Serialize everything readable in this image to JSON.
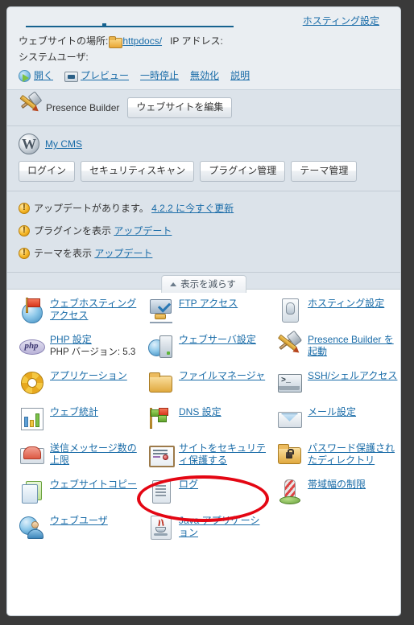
{
  "summary": {
    "hosting_setting_link": "ホスティング設定",
    "website_location_label": "ウェブサイトの場所:",
    "httpdocs_link": "httpdocs/",
    "ip_address_label": "IP アドレス:",
    "system_user_label": "システムユーザ:",
    "actions": [
      {
        "label": "開く",
        "icon": "open-globe-icon"
      },
      {
        "label": "プレビュー",
        "icon": "preview-icon"
      },
      {
        "label": "一時停止",
        "icon": ""
      },
      {
        "label": "無効化",
        "icon": ""
      },
      {
        "label": "説明",
        "icon": ""
      }
    ]
  },
  "presence_builder": {
    "title": "Presence Builder",
    "edit_button": "ウェブサイトを編集",
    "icon": "pencil-hammer-icon"
  },
  "wordpress": {
    "site_link": "My CMS",
    "icon": "wordpress-icon",
    "buttons": [
      "ログイン",
      "セキュリティスキャン",
      "プラグイン管理",
      "テーマ管理"
    ]
  },
  "notifications": [
    {
      "icon": "warning-icon",
      "text": "アップデートがあります。",
      "link": "4.2.2 に今すぐ更新"
    },
    {
      "icon": "warning-icon",
      "text": "プラグインを表示",
      "link": "アップデート"
    },
    {
      "icon": "warning-icon",
      "text": "テーマを表示",
      "link": "アップデート"
    }
  ],
  "collapse_tab": {
    "label": "表示を減らす",
    "icon": "chevron-up-icon"
  },
  "grid": [
    [
      {
        "icon": "web-hosting-access-icon",
        "label": "ウェブホスティングアクセス",
        "sub": ""
      },
      {
        "icon": "ftp-access-icon",
        "label": "FTP アクセス",
        "sub": ""
      },
      {
        "icon": "hosting-settings-icon",
        "label": "ホスティング設定",
        "sub": ""
      }
    ],
    [
      {
        "icon": "php-settings-icon",
        "label": "PHP 設定",
        "sub": "PHP バージョン: 5.3"
      },
      {
        "icon": "web-server-settings-icon",
        "label": "ウェブサーバ設定",
        "sub": ""
      },
      {
        "icon": "presence-builder-icon",
        "label": "Presence Builder を起動",
        "sub": ""
      }
    ],
    [
      {
        "icon": "applications-icon",
        "label": "アプリケーション",
        "sub": ""
      },
      {
        "icon": "file-manager-icon",
        "label": "ファイルマネージャ",
        "sub": ""
      },
      {
        "icon": "ssh-shell-access-icon",
        "label": "SSH/シェルアクセス",
        "sub": ""
      }
    ],
    [
      {
        "icon": "web-statistics-icon",
        "label": "ウェブ統計",
        "sub": ""
      },
      {
        "icon": "dns-settings-icon",
        "label": "DNS 設定",
        "sub": ""
      },
      {
        "icon": "mail-settings-icon",
        "label": "メール設定",
        "sub": ""
      }
    ],
    [
      {
        "icon": "outgoing-mail-limit-icon",
        "label": "送信メッセージ数の上限",
        "sub": ""
      },
      {
        "icon": "secure-site-certificate-icon",
        "label": "サイトをセキュリティ保護する",
        "sub": ""
      },
      {
        "icon": "password-protected-directories-icon",
        "label": "パスワード保護されたディレクトリ",
        "sub": ""
      }
    ],
    [
      {
        "icon": "website-copy-icon",
        "label": "ウェブサイトコピー",
        "sub": ""
      },
      {
        "icon": "logs-icon",
        "label": "ログ",
        "sub": ""
      },
      {
        "icon": "bandwidth-limit-icon",
        "label": "帯域幅の制限",
        "sub": ""
      }
    ],
    [
      {
        "icon": "web-users-icon",
        "label": "ウェブユーザ",
        "sub": ""
      },
      {
        "icon": "java-applications-icon",
        "label": "Java アプリケーション",
        "sub": ""
      }
    ]
  ],
  "annotation": {
    "shape": "ellipse",
    "color": "#e40613",
    "targets": "secure-site-certificate-icon"
  },
  "colors": {
    "link": "#1a6ca8",
    "panel_bg": "#ffffff",
    "summary_bg": "#eaeef2",
    "section_bg": "#dce3ea",
    "annotation_red": "#e40613"
  }
}
